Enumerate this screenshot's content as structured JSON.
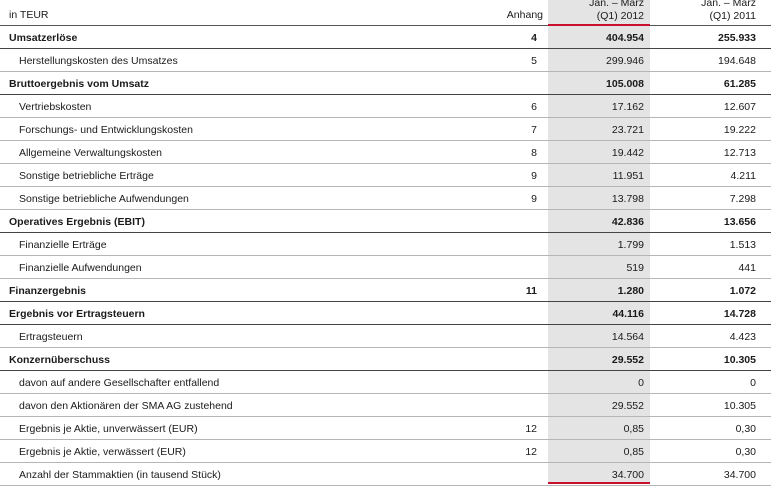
{
  "header": {
    "unit": "in TEUR",
    "note_col": "Anhang",
    "col1_line1": "Jan. – März",
    "col1_line2": "(Q1) 2012",
    "col2_line1": "Jan. – März",
    "col2_line2": "(Q1) 2011"
  },
  "colors": {
    "accent": "#c8102e",
    "shade": "#e4e4e4"
  },
  "rows": [
    {
      "label": "Umsatzerlöse",
      "note": "4",
      "q1_2012": "404.954",
      "q1_2011": "255.933",
      "bold": true
    },
    {
      "label": "Herstellungskosten des Umsatzes",
      "note": "5",
      "q1_2012": "299.946",
      "q1_2011": "194.648",
      "bold": false
    },
    {
      "label": "Bruttoergebnis vom Umsatz",
      "note": "",
      "q1_2012": "105.008",
      "q1_2011": "61.285",
      "bold": true
    },
    {
      "label": "Vertriebskosten",
      "note": "6",
      "q1_2012": "17.162",
      "q1_2011": "12.607",
      "bold": false
    },
    {
      "label": "Forschungs- und Entwicklungskosten",
      "note": "7",
      "q1_2012": "23.721",
      "q1_2011": "19.222",
      "bold": false
    },
    {
      "label": "Allgemeine Verwaltungskosten",
      "note": "8",
      "q1_2012": "19.442",
      "q1_2011": "12.713",
      "bold": false
    },
    {
      "label": "Sonstige betriebliche Erträge",
      "note": "9",
      "q1_2012": "11.951",
      "q1_2011": "4.211",
      "bold": false
    },
    {
      "label": "Sonstige betriebliche Aufwendungen",
      "note": "9",
      "q1_2012": "13.798",
      "q1_2011": "7.298",
      "bold": false
    },
    {
      "label": "Operatives Ergebnis (EBIT)",
      "note": "",
      "q1_2012": "42.836",
      "q1_2011": "13.656",
      "bold": true
    },
    {
      "label": "Finanzielle Erträge",
      "note": "",
      "q1_2012": "1.799",
      "q1_2011": "1.513",
      "bold": false
    },
    {
      "label": "Finanzielle Aufwendungen",
      "note": "",
      "q1_2012": "519",
      "q1_2011": "441",
      "bold": false
    },
    {
      "label": "Finanzergebnis",
      "note": "11",
      "q1_2012": "1.280",
      "q1_2011": "1.072",
      "bold": true
    },
    {
      "label": "Ergebnis vor Ertragsteuern",
      "note": "",
      "q1_2012": "44.116",
      "q1_2011": "14.728",
      "bold": true
    },
    {
      "label": "Ertragsteuern",
      "note": "",
      "q1_2012": "14.564",
      "q1_2011": "4.423",
      "bold": false
    },
    {
      "label": "Konzernüberschuss",
      "note": "",
      "q1_2012": "29.552",
      "q1_2011": "10.305",
      "bold": true
    },
    {
      "label": "davon auf andere Gesellschafter entfallend",
      "note": "",
      "q1_2012": "0",
      "q1_2011": "0",
      "bold": false
    },
    {
      "label": "davon den Aktionären der SMA AG zustehend",
      "note": "",
      "q1_2012": "29.552",
      "q1_2011": "10.305",
      "bold": false
    },
    {
      "label": "Ergebnis je Aktie, unverwässert (EUR)",
      "note": "12",
      "q1_2012": "0,85",
      "q1_2011": "0,30",
      "bold": false
    },
    {
      "label": "Ergebnis je Aktie, verwässert (EUR)",
      "note": "12",
      "q1_2012": "0,85",
      "q1_2011": "0,30",
      "bold": false
    },
    {
      "label": "Anzahl der Stammaktien (in tausend Stück)",
      "note": "",
      "q1_2012": "34.700",
      "q1_2011": "34.700",
      "bold": false
    }
  ]
}
